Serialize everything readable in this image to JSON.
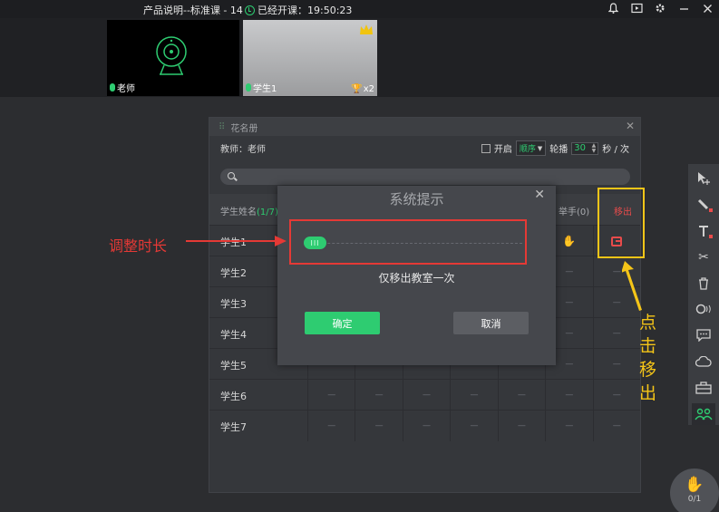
{
  "titlebar": {
    "title": "产品说明--标准课 - 14",
    "class_status": "已经开课：19:50:23"
  },
  "videos": {
    "teacher_label": "老师",
    "student_label": "学生1",
    "student_trophies": "x2"
  },
  "roster": {
    "title": "花名册",
    "teacher_line": "教师：老师",
    "open_label": "开启",
    "order_value": "顺序",
    "rotate_label": "轮播",
    "rotate_seconds": "30",
    "per_unit": "秒 / 次",
    "col_name": "学生姓名",
    "col_count": "(1/7)",
    "col_hand": "举手(0)",
    "col_remove": "移出",
    "students": [
      "学生1",
      "学生2",
      "学生3",
      "学生4",
      "学生5",
      "学生6",
      "学生7"
    ],
    "empty_cell": "—"
  },
  "dialog": {
    "title": "系统提示",
    "slider_glyph": "III",
    "message": "仅移出教室一次",
    "ok_label": "确定",
    "cancel_label": "取消"
  },
  "annotations": {
    "left_label": "调整时长",
    "right_label": "点击移出"
  },
  "hand_counter": "0/1",
  "colors": {
    "accent": "#2ecc71",
    "danger": "#e84b4b",
    "annotation_red": "#e53935",
    "annotation_yellow": "#f5c518"
  }
}
